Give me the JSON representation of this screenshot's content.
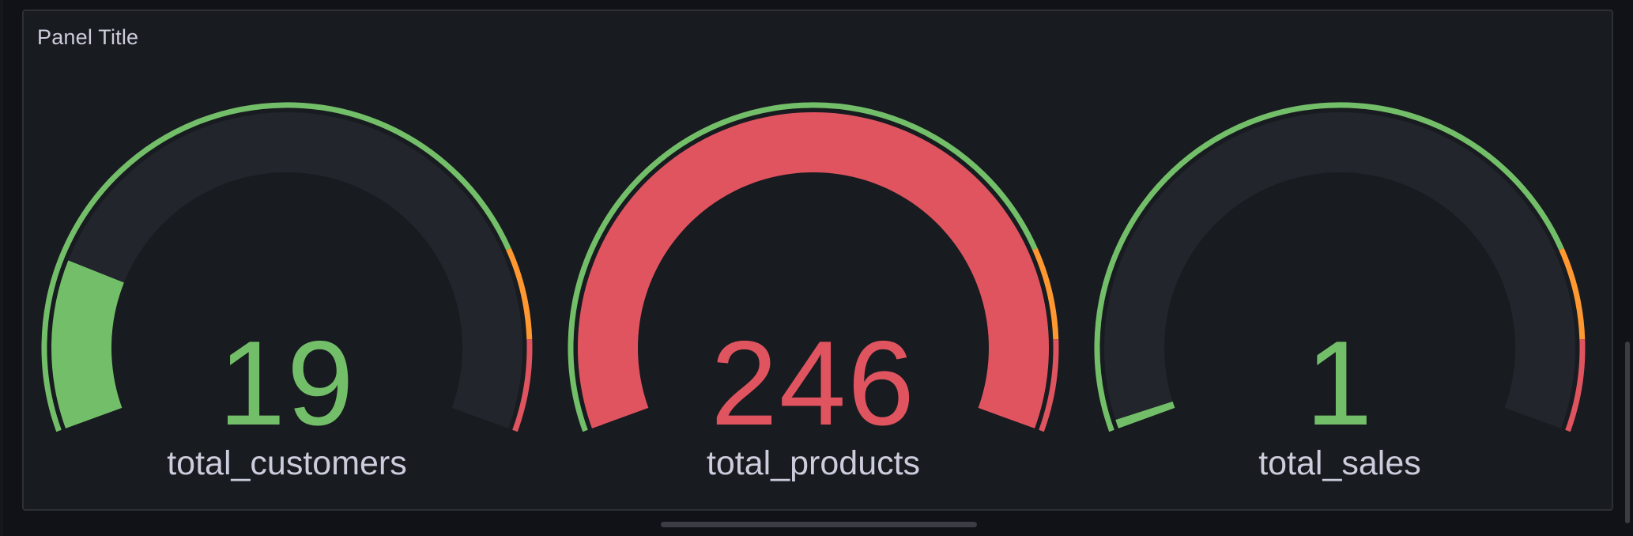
{
  "panel": {
    "title": "Panel Title"
  },
  "gauges": [
    {
      "label": "total_customers",
      "value": "19",
      "num": 19,
      "color": "#73bf69"
    },
    {
      "label": "total_products",
      "value": "246",
      "num": 246,
      "color": "#e05460"
    },
    {
      "label": "total_sales",
      "value": "1",
      "num": 1,
      "color": "#73bf69"
    }
  ],
  "gauge_scale": {
    "min": 0,
    "max": 100,
    "thresholds": [
      {
        "from": 0,
        "color": "#73bf69"
      },
      {
        "from": 80,
        "color": "#ff9830"
      },
      {
        "from": 90,
        "color": "#e05460"
      }
    ],
    "track_color": "#22252b"
  }
}
